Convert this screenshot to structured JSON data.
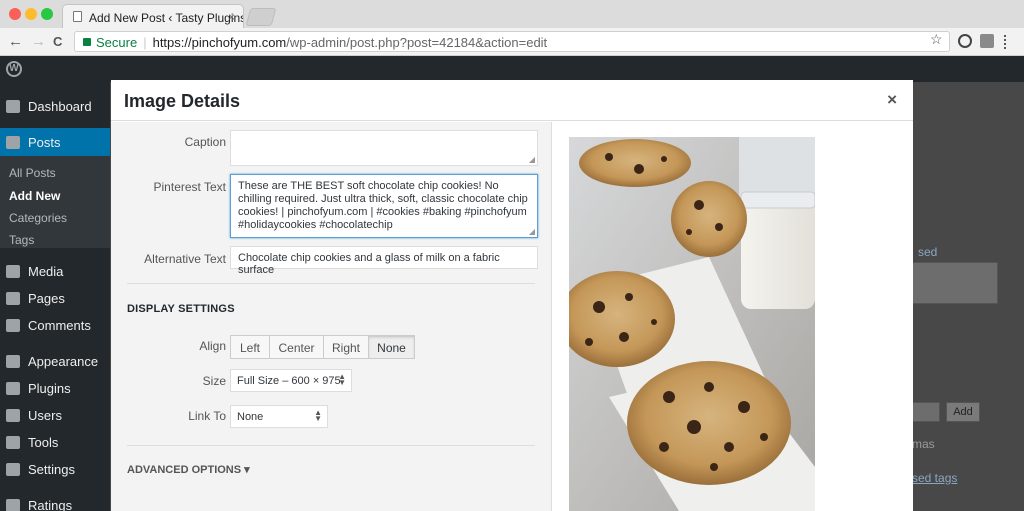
{
  "browser": {
    "tab_title": "Add New Post ‹ Tasty Plugins —",
    "tab_close": "×",
    "secure_label": "Secure",
    "url_host": "https://pinchofyum.com",
    "url_rest": "/wp-admin/post.php?post=42184&action=edit",
    "nav_back": "←",
    "nav_forward": "→",
    "nav_reload": "C",
    "star": "☆"
  },
  "sidebar": {
    "items": [
      {
        "label": "Dashboard"
      },
      {
        "label": "Posts"
      },
      {
        "label": "Media"
      },
      {
        "label": "Pages"
      },
      {
        "label": "Comments"
      },
      {
        "label": "Appearance"
      },
      {
        "label": "Plugins"
      },
      {
        "label": "Users"
      },
      {
        "label": "Tools"
      },
      {
        "label": "Settings"
      },
      {
        "label": "Ratings"
      }
    ],
    "subitems": [
      {
        "label": "All Posts"
      },
      {
        "label": "Add New"
      },
      {
        "label": "Categories"
      },
      {
        "label": "Tags"
      }
    ]
  },
  "background": {
    "frag1": "sed",
    "add_button": "Add",
    "frag2": "mas",
    "frag3": "sed tags"
  },
  "modal": {
    "title": "Image Details",
    "close": "×",
    "caption_label": "Caption",
    "caption_value": "",
    "pinterest_label": "Pinterest Text",
    "pinterest_value": "These are THE BEST soft chocolate chip cookies! No chilling required. Just ultra thick, soft, classic chocolate chip cookies! | pinchofyum.com | #cookies #baking #pinchofyum #holidaycookies #chocolatechip",
    "alt_label": "Alternative Text",
    "alt_value": "Chocolate chip cookies and a glass of milk on a fabric surface",
    "display_settings": "DISPLAY SETTINGS",
    "align_label": "Align",
    "align_options": [
      "Left",
      "Center",
      "Right",
      "None"
    ],
    "align_selected": "None",
    "size_label": "Size",
    "size_value": "Full Size – 600 × 975",
    "link_label": "Link To",
    "link_value": "None",
    "advanced_options": "ADVANCED OPTIONS ▾"
  }
}
